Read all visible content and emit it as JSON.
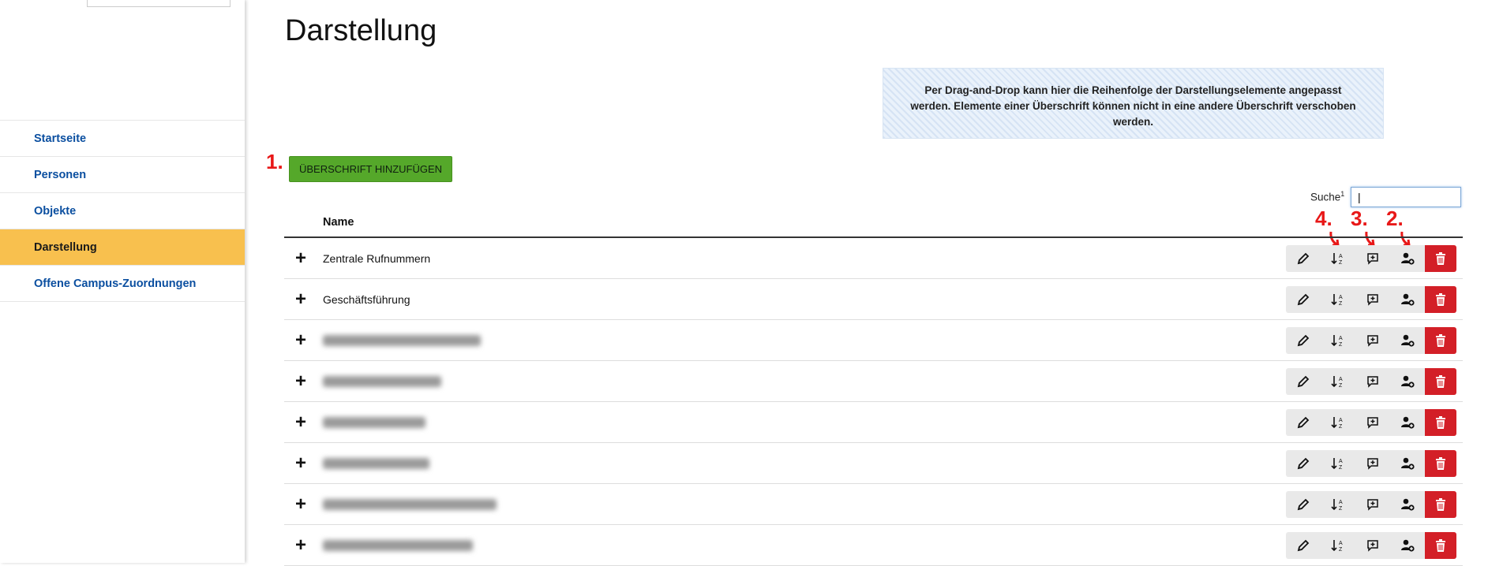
{
  "sidebar": {
    "items": [
      {
        "label": "Startseite"
      },
      {
        "label": "Personen"
      },
      {
        "label": "Objekte"
      },
      {
        "label": "Darstellung"
      },
      {
        "label": "Offene Campus-Zuordnungen"
      }
    ],
    "active": "Darstellung"
  },
  "page": {
    "title": "Darstellung",
    "info": "Per Drag-and-Drop kann hier die Reihenfolge der Darstellungselemente angepasst werden. Elemente einer Überschrift können nicht in eine andere Überschrift verschoben werden.",
    "add_heading_label": "ÜBERSCHRIFT HINZUFÜGEN",
    "search_label": "Suche",
    "search_sup": "1",
    "search_value": "|"
  },
  "annotations": {
    "step1": "1.",
    "step2": "2.",
    "step3": "3.",
    "step4": "4."
  },
  "table": {
    "header_name": "Name",
    "rows": [
      {
        "name": "Zentrale Rufnummern",
        "blurred": false
      },
      {
        "name": "Geschäftsführung",
        "blurred": false
      },
      {
        "name": "",
        "blurred": true
      },
      {
        "name": "",
        "blurred": true
      },
      {
        "name": "",
        "blurred": true
      },
      {
        "name": "",
        "blurred": true
      },
      {
        "name": "",
        "blurred": true
      },
      {
        "name": "",
        "blurred": true
      }
    ],
    "row_icons": [
      "pencil-icon",
      "sort-az-icon",
      "comment-plus-icon",
      "add-person-icon",
      "trash-icon"
    ]
  },
  "colors": {
    "accent_active": "#f8c04e",
    "link": "#0b4fa0",
    "add_button": "#55a82a",
    "delete": "#d31f27",
    "annotation": "#e81818"
  }
}
